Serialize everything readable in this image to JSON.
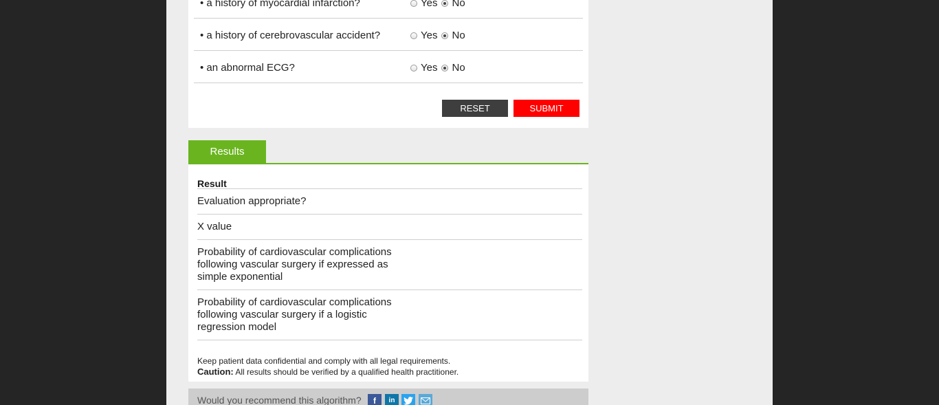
{
  "questions": [
    {
      "label": "• a history of myocardial infarction?",
      "options": [
        "Yes",
        "No"
      ],
      "selected": "No"
    },
    {
      "label": "• a history of cerebrovascular accident?",
      "options": [
        "Yes",
        "No"
      ],
      "selected": "No"
    },
    {
      "label": "• an abnormal ECG?",
      "options": [
        "Yes",
        "No"
      ],
      "selected": "No"
    }
  ],
  "buttons": {
    "reset": "RESET",
    "submit": "SUBMIT"
  },
  "results": {
    "tab": "Results",
    "heading": "Result",
    "rows": [
      "Evaluation appropriate?",
      "X value",
      "Probability of cardiovascular complications following vascular surgery if expressed as simple exponential",
      "Probability of cardiovascular complications following vascular surgery if a logistic regression model"
    ],
    "note": "Keep patient data confidential and comply with all legal requirements.",
    "caution_label": "Caution:",
    "caution_text": "All results should be verified by a qualified health practitioner."
  },
  "recommend": {
    "text": "Would you recommend this algorithm?",
    "icons": [
      "facebook-icon",
      "linkedin-icon",
      "twitter-icon",
      "email-icon"
    ]
  },
  "colors": {
    "accent_green": "#6ab51f",
    "submit_red": "#ff0000",
    "reset_dark": "#3e3e3e",
    "side_dark": "#252525"
  }
}
